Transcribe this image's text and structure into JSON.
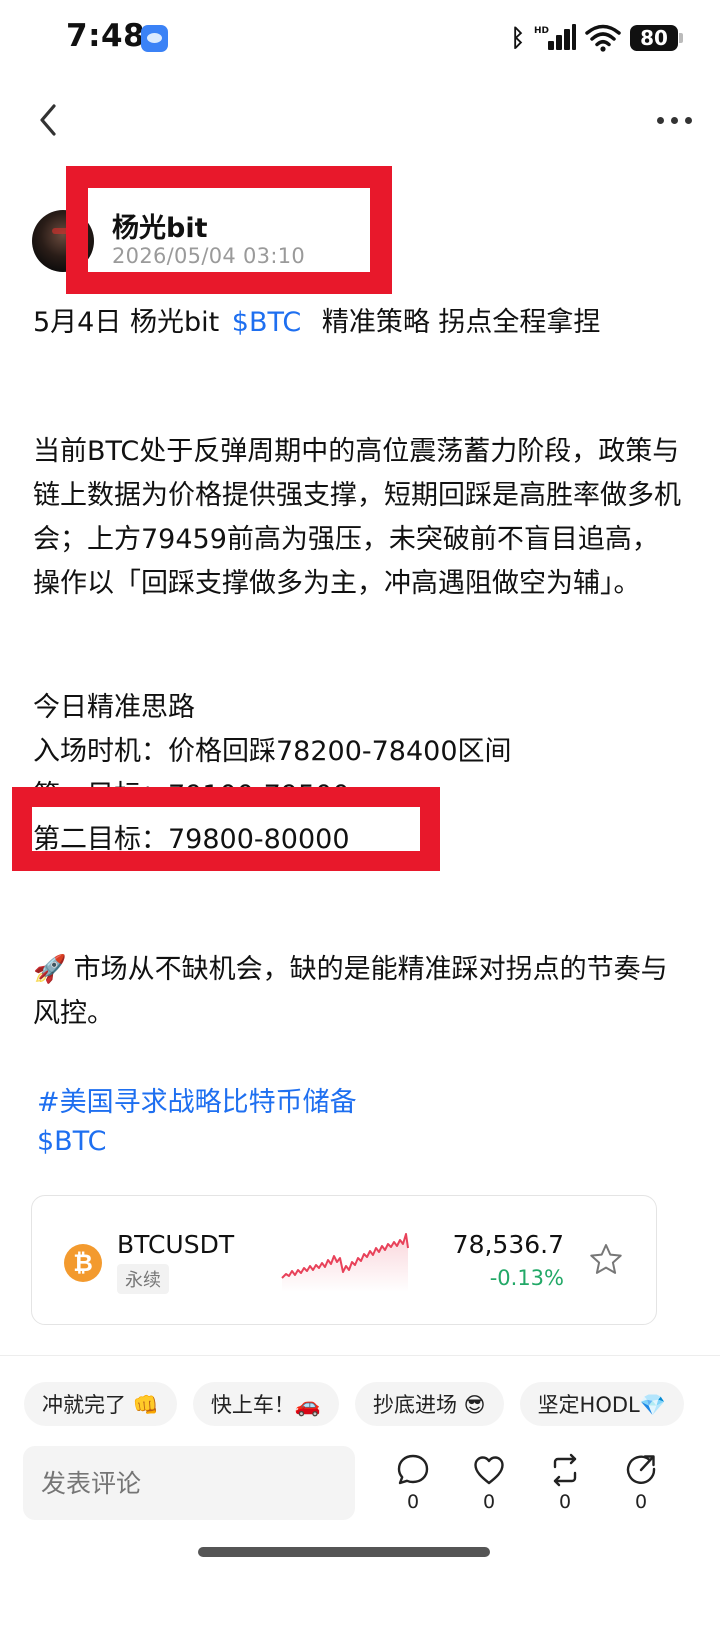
{
  "status_bar": {
    "time": "7:48",
    "battery": "80"
  },
  "author": {
    "name": "杨光bit",
    "timestamp": "2026/05/04 03:10"
  },
  "post": {
    "title_prefix": "5月4日 杨光bit",
    "title_cashtag": "$BTC",
    "title_suffix": "精准策略 拐点全程拿捏",
    "paragraph": "当前BTC处于反弹周期中的高位震荡蓄力阶段，政策与链上数据为价格提供强支撑，短期回踩是高胜率做多机会；上方79459前高为强压，未突破前不盲目追高，操作以「回踩支撑做多为主，冲高遇阻做空为辅」。",
    "strategy_heading": "今日精准思路",
    "entry": "入场时机：价格回踩78200-78400区间",
    "target1": "第一目标：79100-79500",
    "target2": "第二目标：79800-80000",
    "closing": "市场从不缺机会，缺的是能精准踩对拐点的节奏与风控。",
    "hashtag": "#美国寻求战略比特币储备",
    "cashtag": "$BTC"
  },
  "ticker": {
    "symbol": "BTCUSDT",
    "type": "永续",
    "price": "78,536.7",
    "change": "-0.13%",
    "up_color": "#22a867",
    "line_color": "#e8425a"
  },
  "reactions": [
    "冲就完了 👊",
    "快上车！🚗",
    "抄底进场 😎",
    "坚定HODL💎"
  ],
  "comment": {
    "placeholder": "发表评论"
  },
  "actions": {
    "comment_count": "0",
    "like_count": "0",
    "repost_count": "0",
    "share_count": "0"
  }
}
